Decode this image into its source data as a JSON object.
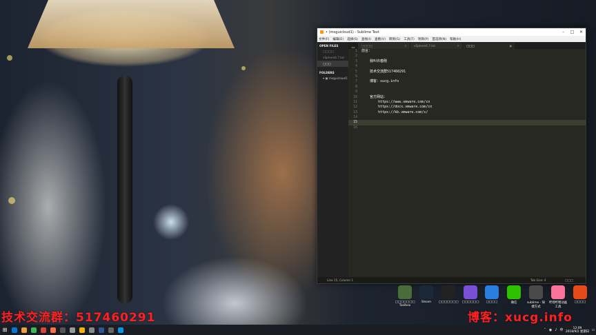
{
  "editor": {
    "title": "• (moguicloud1) - Sublime Text",
    "menu": [
      "文件(F)",
      "编辑(E)",
      "选择(S)",
      "查找(I)",
      "查看(V)",
      "转到(G)",
      "工具(T)",
      "项目(P)",
      "首选项(N)",
      "帮助(H)"
    ],
    "tabs": [
      {
        "label": "□□□□"
      },
      {
        "label": "vSphere6.7.txt"
      },
      {
        "label": "□□□"
      }
    ],
    "sidebar": {
      "open_files_heading": "OPEN FILES",
      "open_files": [
        "□□□□",
        "vSphere6.7.txt",
        "□□□"
      ],
      "folders_heading": "FOLDERS",
      "folder": "moguicloud1"
    },
    "lines": [
      "前言：",
      "",
      "    我叫许春刚",
      "",
      "    技术交流群517460291",
      "",
      "    博客：xucg.info",
      "",
      "",
      "    官方网站：",
      "        https://www.vmware.com/cn",
      "        https://docs.vmware.com/cn",
      "        https://kb.vmware.com/s/",
      "",
      "",
      ""
    ],
    "line_numbers": [
      "1",
      "2",
      "3",
      "4",
      "5",
      "6",
      "7",
      "8",
      "9",
      "10",
      "11",
      "12",
      "13",
      "14",
      "15",
      "16"
    ],
    "status": {
      "position": "Line 15, Column 1",
      "tab_size": "Tab Size: 4",
      "syntax": "□□□"
    }
  },
  "desktop_icons": [
    {
      "label": "□□□□□□□ Toolbox",
      "color": "#4a6b3a"
    },
    {
      "label": "Steam",
      "color": "#1b2838"
    },
    {
      "label": "□□□□□□□",
      "color": "#222"
    },
    {
      "label": "□□□□□□",
      "color": "#7a4fd8"
    },
    {
      "label": "□□□□",
      "color": "#2a7de1"
    },
    {
      "label": "微信",
      "color": "#2dc100"
    },
    {
      "label": "sublime - 快捷方式",
      "color": "#4a4a4a"
    },
    {
      "label": "哔哩哔哩动画 工具",
      "color": "#fb7299"
    },
    {
      "label": "□□□□",
      "color": "#e64a19"
    }
  ],
  "watermarks": {
    "left": "技术交流群：517460291",
    "right": "博客：xucg.info"
  },
  "taskbar": {
    "apps": [
      "#0078d7",
      "#e8a33d",
      "#3cba54",
      "#db4437",
      "#ff7043",
      "#555",
      "#999",
      "#f4b400",
      "#888",
      "#2b579a",
      "#666",
      "#0099e5"
    ],
    "time": "12:09",
    "date": "2018/9/2 星期日"
  }
}
